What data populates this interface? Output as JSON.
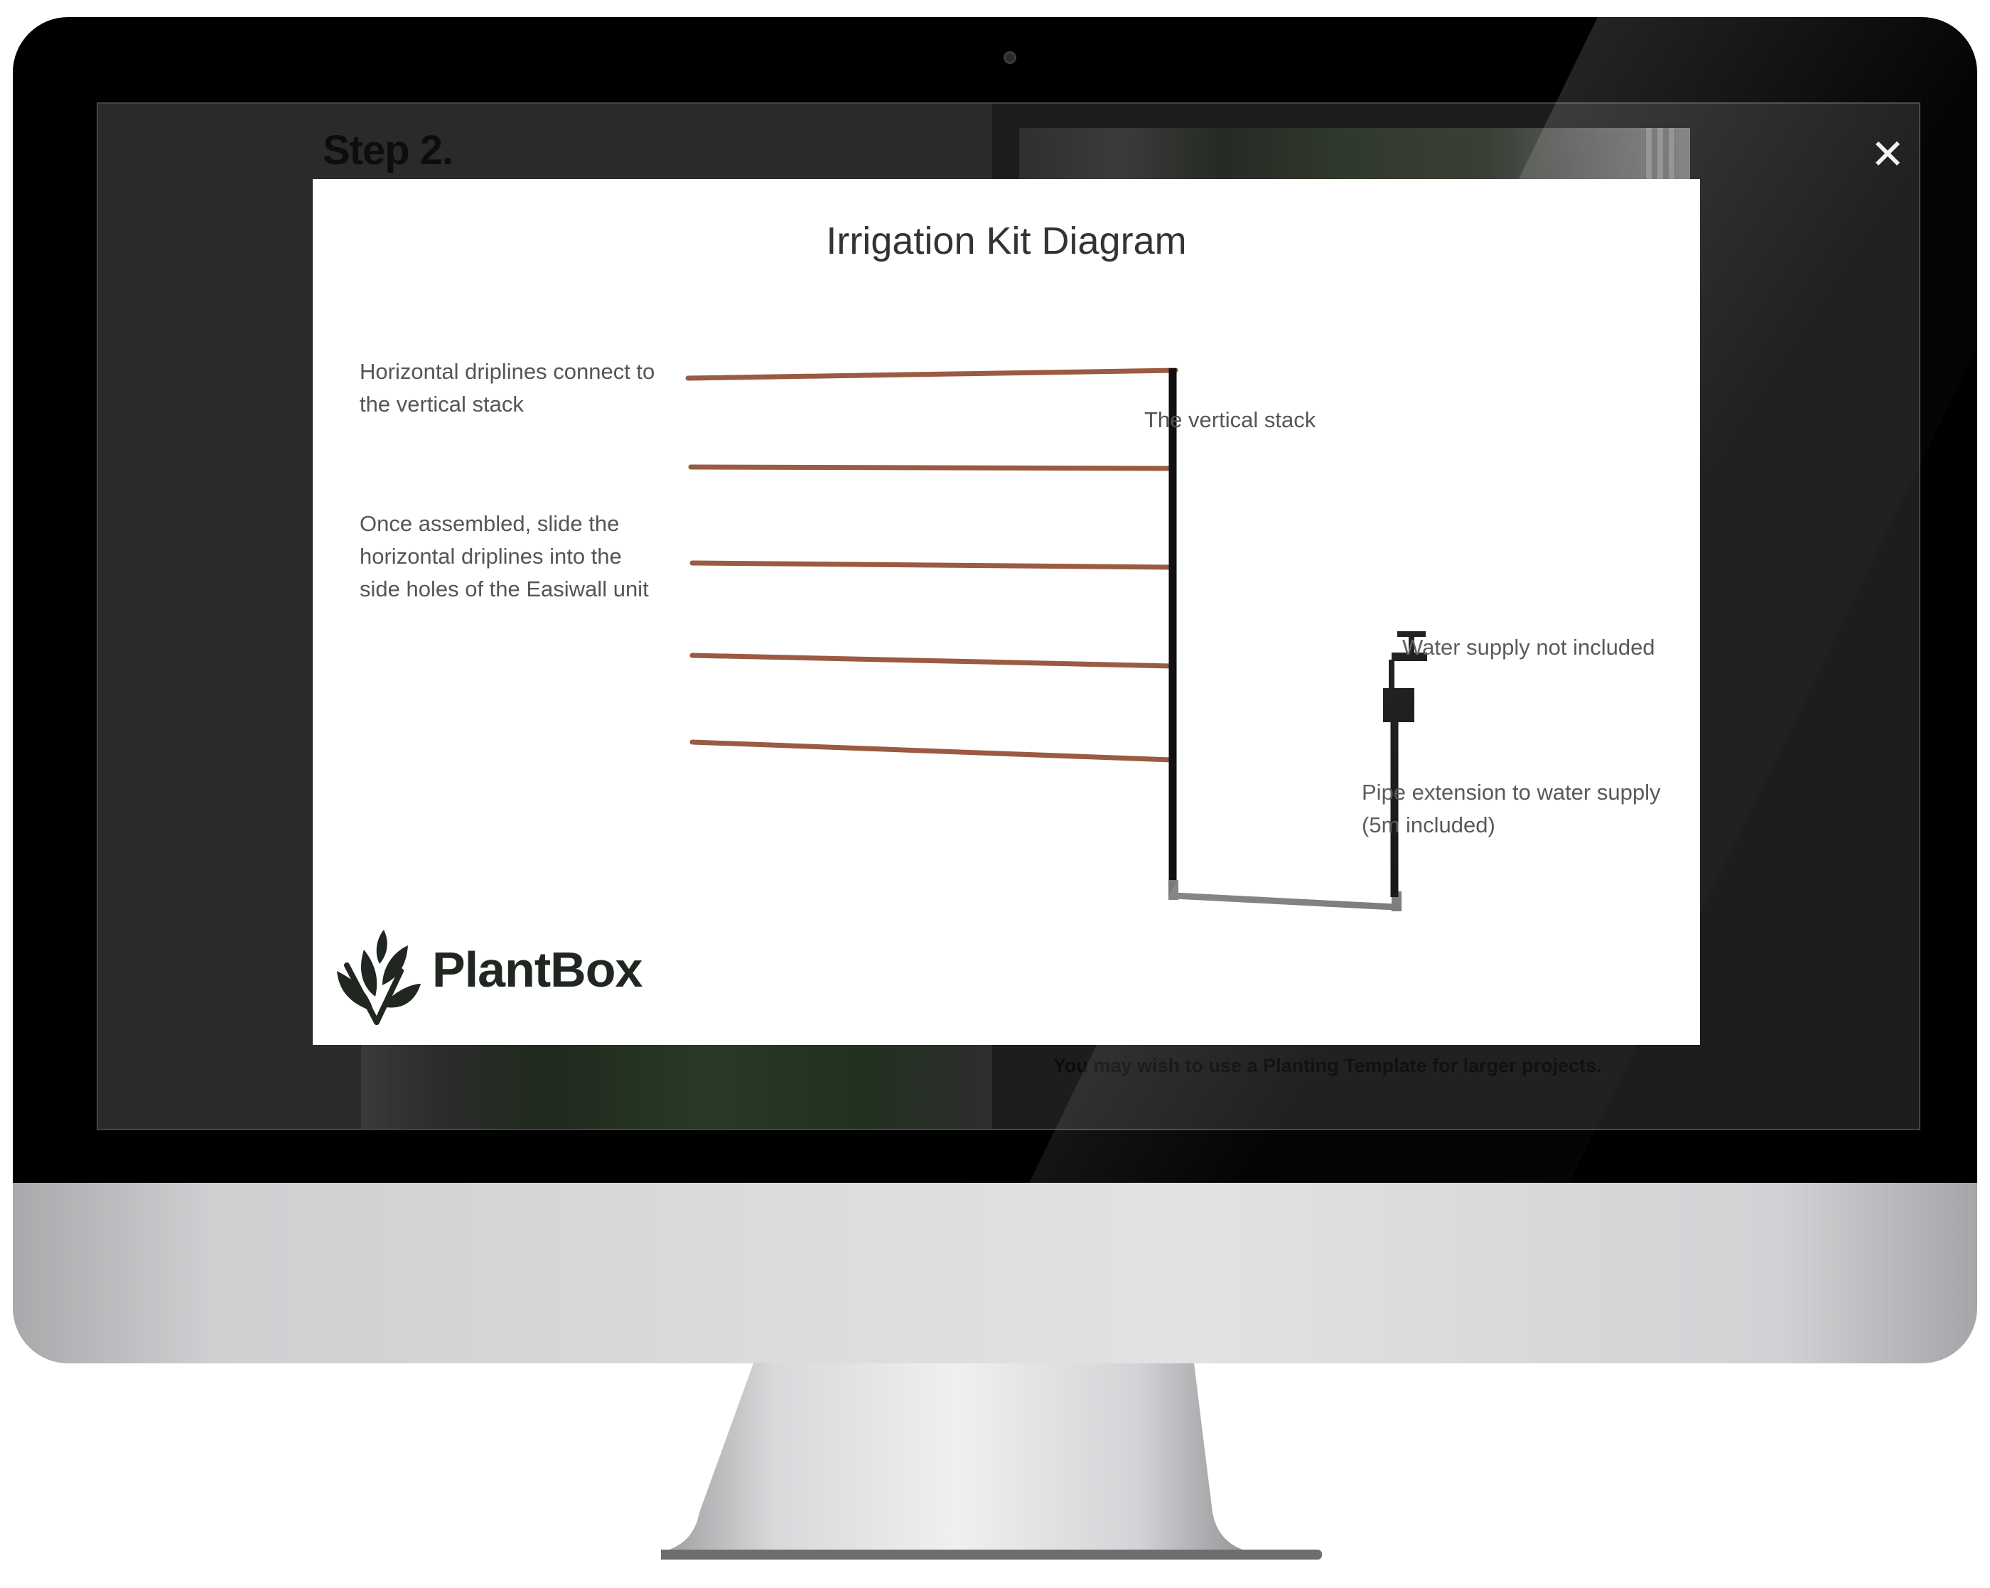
{
  "page": {
    "step_title": "Step 2.",
    "background_text": "You may wish to use a Planting Template for larger projects.",
    "close_label": "✕"
  },
  "modal": {
    "title": "Irrigation Kit Diagram",
    "labels": {
      "horizontal_driplines": "Horizontal driplines connect to the vertical stack",
      "slide_instruction": "Once assembled, slide the horizontal driplines into the side holes of the Easiwall unit",
      "vertical_stack": "The vertical stack",
      "water_supply": "Water supply not included",
      "pipe_extension": "Pipe extension to water supply (5m included)"
    },
    "logo_text": "PlantBox",
    "colors": {
      "dripline": "#9a5a43",
      "stack": "#111111",
      "base_pipe": "#7a7a7a",
      "logo": "#202720"
    },
    "icons": [
      "close-icon",
      "water-tap-icon",
      "plant-leaf-logo-icon"
    ]
  }
}
